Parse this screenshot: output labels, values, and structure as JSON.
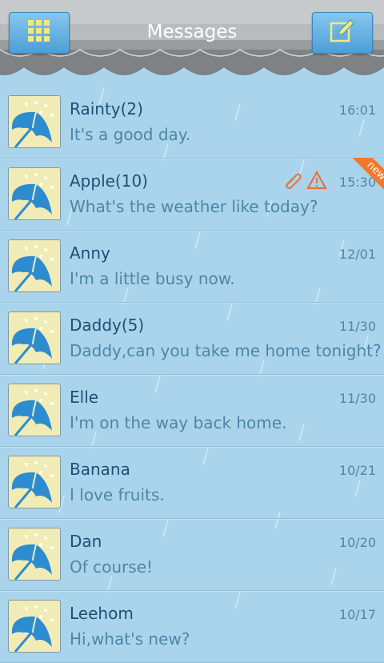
{
  "header": {
    "title": "Messages",
    "menu_icon": "grid-icon",
    "compose_icon": "compose-icon"
  },
  "colors": {
    "background": "#a9d4ec",
    "accent": "#f07a2c",
    "name": "#1f4f74",
    "secondary": "#4f86a6"
  },
  "threads": [
    {
      "name": "Rainty(2)",
      "preview": "It's a good day.",
      "time": "16:01"
    },
    {
      "name": "Apple(10)",
      "preview": "What's the weather like today?",
      "time": "15:30",
      "new_label": "new"
    },
    {
      "name": "Anny",
      "preview": "I'm a little busy now.",
      "time": "12/01"
    },
    {
      "name": "Daddy(5)",
      "preview": "Daddy,can you take me home tonight?",
      "time": "11/30"
    },
    {
      "name": "Elle",
      "preview": "I'm on the way back home.",
      "time": "11/30"
    },
    {
      "name": "Banana",
      "preview": "I love fruits.",
      "time": "10/21"
    },
    {
      "name": "Dan",
      "preview": "Of course!",
      "time": "10/20"
    },
    {
      "name": "Leehom",
      "preview": "Hi,what's new?",
      "time": "10/17"
    }
  ]
}
